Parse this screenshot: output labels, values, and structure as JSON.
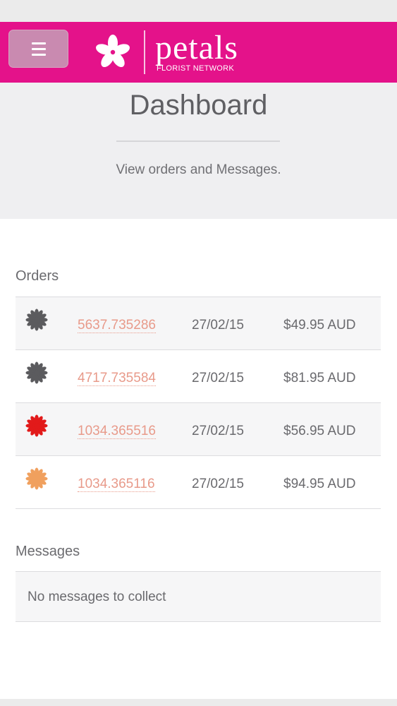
{
  "header": {
    "brand_name": "petals",
    "brand_tagline": "FLORIST NETWORK",
    "brand_color": "#e4128a",
    "menu_icon": "hamburger-menu-icon"
  },
  "hero": {
    "title": "Dashboard",
    "subtitle": "View orders and Messages."
  },
  "orders": {
    "label": "Orders",
    "rows": [
      {
        "status_icon": "flower-icon",
        "status_color": "#5b5b5e",
        "order_id": "5637.735286",
        "date": "27/02/15",
        "amount": "$49.95 AUD"
      },
      {
        "status_icon": "flower-icon",
        "status_color": "#5b5b5e",
        "order_id": "4717.735584",
        "date": "27/02/15",
        "amount": "$81.95 AUD"
      },
      {
        "status_icon": "flower-icon",
        "status_color": "#e21a1a",
        "order_id": "1034.365516",
        "date": "27/02/15",
        "amount": "$56.95 AUD"
      },
      {
        "status_icon": "flower-icon",
        "status_color": "#f0a05e",
        "order_id": "1034.365116",
        "date": "27/02/15",
        "amount": "$94.95 AUD"
      }
    ]
  },
  "messages": {
    "label": "Messages",
    "empty_text": "No messages to collect"
  }
}
